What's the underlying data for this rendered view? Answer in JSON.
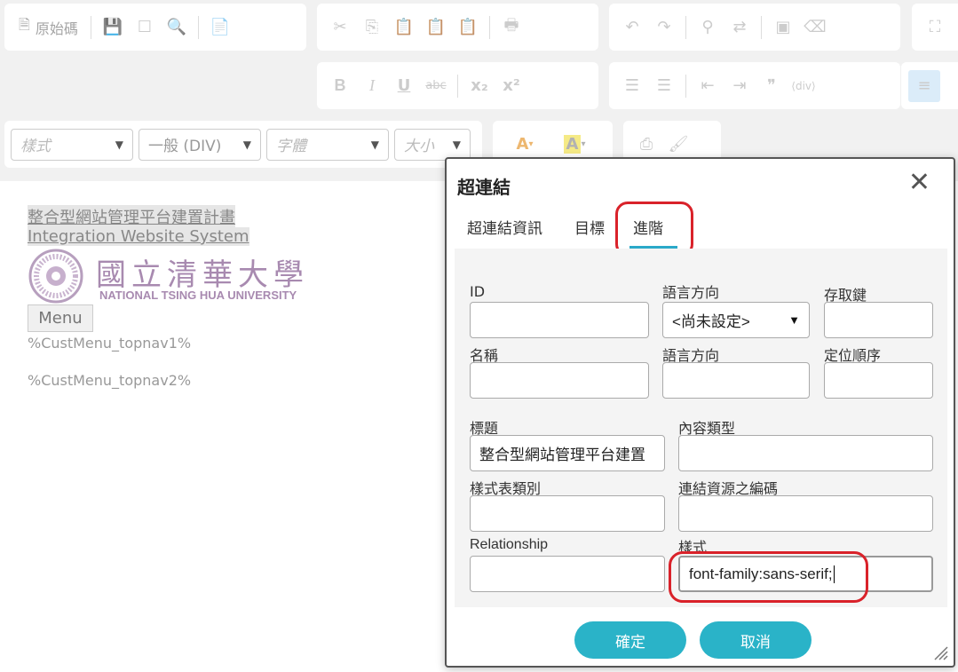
{
  "toolbar": {
    "source_label": "原始碼",
    "combo_style": "樣式",
    "combo_format": "一般 (DIV)",
    "combo_font": "字體",
    "combo_size": "大小",
    "bold": "B",
    "italic": "I",
    "underline": "U",
    "strike": "abc",
    "subscript": "x₂",
    "superscript": "x²",
    "quote": "❞",
    "text_color": "A",
    "bg_color": "A"
  },
  "content": {
    "link_cn": "整合型網站管理平台建置計畫",
    "link_en": "Integration Website System",
    "logo_cn": "國立清華大學",
    "logo_en": "NATIONAL TSING HUA UNIVERSITY",
    "menu_button": "Menu",
    "cust_menu_1": "%CustMenu_topnav1%",
    "cust_menu_2": "%CustMenu_topnav2%"
  },
  "dialog": {
    "title": "超連結",
    "tabs": [
      "超連結資訊",
      "目標",
      "進階"
    ],
    "active_tab": "進階",
    "fields": {
      "id": {
        "label": "ID",
        "value": ""
      },
      "lang_dir": {
        "label": "語言方向",
        "value": "<尚未設定>"
      },
      "access_key": {
        "label": "存取鍵",
        "value": ""
      },
      "name": {
        "label": "名稱",
        "value": ""
      },
      "lang_code": {
        "label": "語言方向",
        "value": ""
      },
      "tab_index": {
        "label": "定位順序",
        "value": ""
      },
      "title": {
        "label": "標題",
        "value": "整合型網站管理平台建置"
      },
      "content_type": {
        "label": "內容類型",
        "value": ""
      },
      "stylesheet_classes": {
        "label": "樣式表類別",
        "value": ""
      },
      "charset": {
        "label": "連結資源之編碼",
        "value": ""
      },
      "relationship": {
        "label": "Relationship",
        "value": ""
      },
      "style": {
        "label": "樣式",
        "value": "font-family:sans-serif;"
      }
    },
    "ok_button": "確定",
    "cancel_button": "取消"
  },
  "colors": {
    "accent": "#2ab3c8",
    "highlight_circle": "#d9222a",
    "logo_purple": "#a88ab0"
  }
}
